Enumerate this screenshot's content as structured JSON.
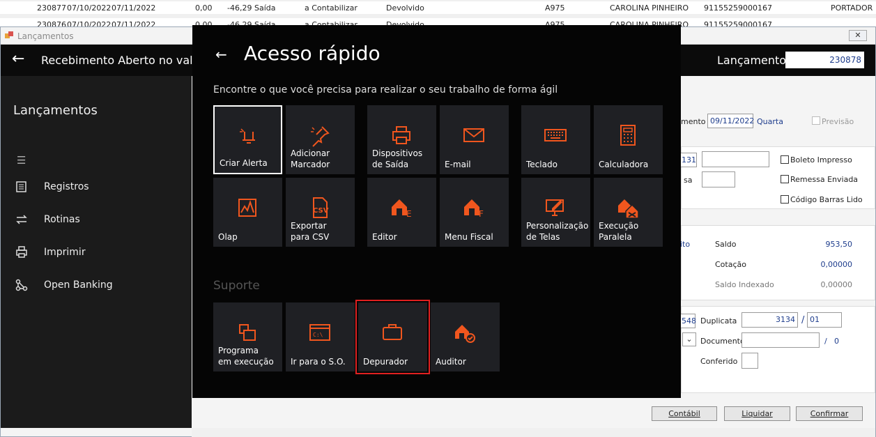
{
  "background_rows": [
    {
      "id": "230877",
      "dt1": "07/10/2022",
      "dt2": "07/11/2022",
      "v1": "0,00",
      "v2": "-46,29",
      "tipo": "Saída",
      "status": "a Contabilizar",
      "situacao": "Devolvido",
      "cod": "A975",
      "nome": "CAROLINA PINHEIRO",
      "cnpj": "91155259000167",
      "portador": "PORTADOR"
    },
    {
      "id": "230876",
      "dt1": "07/10/2022",
      "dt2": "07/11/2022",
      "v1": "0,00",
      "v2": "-46,29",
      "tipo": "Saída",
      "status": "a Contabilizar",
      "situacao": "Devolvido",
      "cod": "A975",
      "nome": "CAROLINA PINHEIRO",
      "cnpj": "91155259000167",
      "portador": ""
    }
  ],
  "window": {
    "title": "Lançamentos",
    "close_glyph": "✕"
  },
  "topbar": {
    "back_glyph": "←",
    "title": "Recebimento Aberto no valor d",
    "lancamento_label": "Lançamento",
    "lancamento_value": "230878"
  },
  "sidebar": {
    "title": "Lançamentos",
    "menu_glyph": "☰",
    "items": [
      {
        "label": "Registros",
        "icon": "registros-icon"
      },
      {
        "label": "Rotinas",
        "icon": "rotinas-icon"
      },
      {
        "label": "Imprimir",
        "icon": "printer-icon"
      },
      {
        "label": "Open Banking",
        "icon": "open-banking-icon"
      }
    ]
  },
  "form": {
    "vencimento_label": "mento",
    "vencimento_value": "09/11/2022",
    "weekday": "Quarta",
    "previsao_label": "Previsão",
    "field_131": "131",
    "field_sa": "sa",
    "boleto_label": "Boleto Impresso",
    "remessa_label": "Remessa Enviada",
    "codigo_label": "Código Barras Lido",
    "ito": "ito",
    "saldo_label": "Saldo",
    "saldo_value": "953,50",
    "cotacao_label": "Cotação",
    "cotacao_value": "0,00000",
    "saldo_idx_label": "Saldo Indexado",
    "saldo_idx_value": "0,00000",
    "f548": "548",
    "duplicata_label": "Duplicata",
    "duplicata_value": "3134",
    "slash": "/",
    "duplicata_seq": "01",
    "documento_label": "Documento",
    "documento_slash": "/",
    "documento_seq": "0",
    "conferido_label": "Conferido"
  },
  "buttons": {
    "contabil": "Contábil",
    "liquidar": "Liquidar",
    "confirmar": "Confirmar"
  },
  "overlay": {
    "back_glyph": "←",
    "title": "Acesso rápido",
    "subtitle": "Encontre o que você precisa para realizar o seu trabalho de forma ágil",
    "support_title": "Suporte",
    "tiles": [
      {
        "label": "Criar Alerta",
        "icon": "alert-icon"
      },
      {
        "label": "Adicionar\nMarcador",
        "icon": "pin-icon"
      },
      {
        "label": "Dispositivos\nde Saída",
        "icon": "printer-icon"
      },
      {
        "label": "E-mail",
        "icon": "mail-icon"
      },
      {
        "label": "Teclado",
        "icon": "keyboard-icon"
      },
      {
        "label": "Calculadora",
        "icon": "calculator-icon"
      },
      {
        "label": "Olap",
        "icon": "olap-icon"
      },
      {
        "label": "Exportar\npara CSV",
        "icon": "csv-icon"
      },
      {
        "label": "Editor",
        "icon": "editor-icon"
      },
      {
        "label": "Menu Fiscal",
        "icon": "fiscal-icon"
      },
      {
        "label": "Personalização\nde Telas",
        "icon": "customize-icon"
      },
      {
        "label": "Execução\nParalela",
        "icon": "parallel-icon"
      }
    ],
    "support_tiles": [
      {
        "label": "Programa\nem execução",
        "icon": "windows-icon"
      },
      {
        "label": "Ir para o S.O.",
        "icon": "terminal-icon"
      },
      {
        "label": "Depurador",
        "icon": "briefcase-icon"
      },
      {
        "label": "Auditor",
        "icon": "auditor-icon"
      }
    ],
    "icon_color": "#f0561e"
  }
}
